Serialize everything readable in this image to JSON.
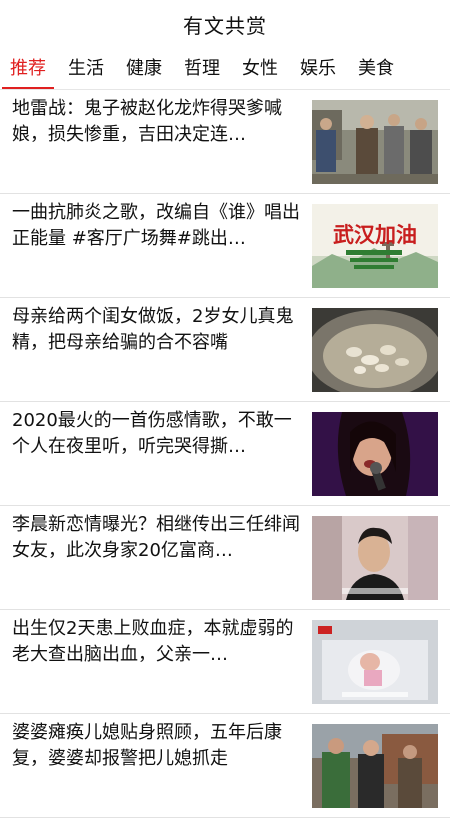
{
  "header": {
    "title": "有文共赏"
  },
  "tabs": [
    {
      "label": "推荐",
      "active": true
    },
    {
      "label": "生活",
      "active": false
    },
    {
      "label": "健康",
      "active": false
    },
    {
      "label": "哲理",
      "active": false
    },
    {
      "label": "女性",
      "active": false
    },
    {
      "label": "娱乐",
      "active": false
    },
    {
      "label": "美食",
      "active": false
    }
  ],
  "theme": {
    "accent": "#e02020",
    "divider": "#e2e2e2"
  },
  "feed": {
    "items": [
      {
        "title": "地雷战：鬼子被赵化龙炸得哭爹喊娘，损失惨重，吉田决定连…",
        "thumbnail": "drama-scene-image"
      },
      {
        "title": "一曲抗肺炎之歌，改编自《谁》唱出正能量 #客厅广场舞#跳出…",
        "thumbnail": "wuhan-poster-image",
        "thumb_text": "武汉加油"
      },
      {
        "title": "母亲给两个闺女做饭，2岁女儿真鬼精，把母亲给骗的合不容嘴",
        "thumbnail": "cooking-wok-image"
      },
      {
        "title": "2020最火的一首伤感情歌，不敢一个人在夜里听，听完哭得撕…",
        "thumbnail": "singer-performance-image"
      },
      {
        "title": "李晨新恋情曝光？相继传出三任绯闻女友，此次身家20亿富商…",
        "thumbnail": "celebrity-photo-image"
      },
      {
        "title": "出生仅2天患上败血症，本就虚弱的老大查出脑出血，父亲一…",
        "thumbnail": "newborn-hospital-image"
      },
      {
        "title": "婆婆瘫痪儿媳贴身照顾，五年后康复，婆婆却报警把儿媳抓走",
        "thumbnail": "village-scene-image"
      }
    ]
  }
}
